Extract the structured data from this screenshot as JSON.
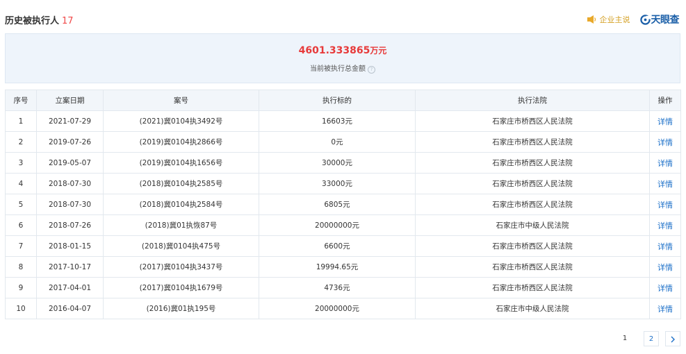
{
  "header": {
    "title": "历史被执行人",
    "count": "17",
    "enterprise_label": "企业主说",
    "logo_text": "天眼查"
  },
  "summary": {
    "amount": "4601.333865",
    "unit": "万元",
    "label": "当前被执行总金额",
    "help_glyph": "?"
  },
  "table": {
    "headers": [
      "序号",
      "立案日期",
      "案号",
      "执行标的",
      "执行法院",
      "操作"
    ],
    "rows": [
      [
        "1",
        "2021-07-29",
        "(2021)冀0104执3492号",
        "16603元",
        "石家庄市桥西区人民法院",
        "详情"
      ],
      [
        "2",
        "2019-07-26",
        "(2019)冀0104执2866号",
        "0元",
        "石家庄市桥西区人民法院",
        "详情"
      ],
      [
        "3",
        "2019-05-07",
        "(2019)冀0104执1656号",
        "30000元",
        "石家庄市桥西区人民法院",
        "详情"
      ],
      [
        "4",
        "2018-07-30",
        "(2018)冀0104执2585号",
        "33000元",
        "石家庄市桥西区人民法院",
        "详情"
      ],
      [
        "5",
        "2018-07-30",
        "(2018)冀0104执2584号",
        "6805元",
        "石家庄市桥西区人民法院",
        "详情"
      ],
      [
        "6",
        "2018-07-26",
        "(2018)冀01执恢87号",
        "20000000元",
        "石家庄市中级人民法院",
        "详情"
      ],
      [
        "7",
        "2018-01-15",
        "(2018)冀0104执475号",
        "6600元",
        "石家庄市桥西区人民法院",
        "详情"
      ],
      [
        "8",
        "2017-10-17",
        "(2017)冀0104执3437号",
        "19994.65元",
        "石家庄市桥西区人民法院",
        "详情"
      ],
      [
        "9",
        "2017-04-01",
        "(2017)冀0104执1679号",
        "4736元",
        "石家庄市桥西区人民法院",
        "详情"
      ],
      [
        "10",
        "2016-04-07",
        "(2016)冀01执195号",
        "20000000元",
        "石家庄市中级人民法院",
        "详情"
      ]
    ]
  },
  "pagination": {
    "current": "1",
    "pages": [
      "2"
    ],
    "next_icon": "chevron-right-icon"
  },
  "colors": {
    "accent_red": "#e73a3a",
    "link_blue": "#1b6fc8",
    "brand_gold": "#d5a126"
  }
}
